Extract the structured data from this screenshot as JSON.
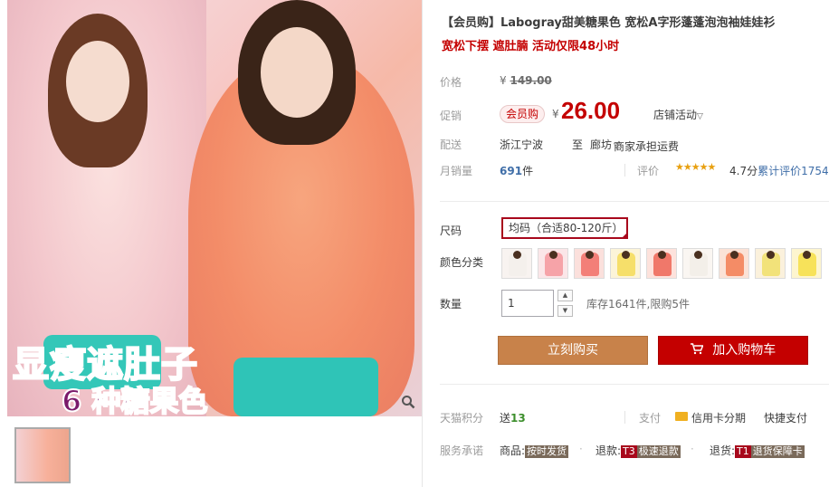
{
  "gallery": {
    "promo_line1": "显瘦遮肚子",
    "promo_line2": "6 种糖果色",
    "zoom_icon": "magnifier-icon"
  },
  "product": {
    "title": "【会员购】Labogray甜美糖果色 宽松A字形蓬蓬泡泡袖娃娃衫",
    "subtitle": "宽松下摆 遮肚腩 活动仅限48小时"
  },
  "price": {
    "label": "价格",
    "currency": "¥",
    "original": "149.00"
  },
  "promo": {
    "label": "促销",
    "badge": "会员购",
    "currency": "¥",
    "price": "26.00",
    "store_activity": "店铺活动",
    "store_activity_icon": "chevron-down-icon"
  },
  "delivery": {
    "label": "配送",
    "from": "浙江宁波",
    "to_word": "至",
    "destination": "廊坊",
    "destination_icon": "chevron-down-icon",
    "fee": "商家承担运费"
  },
  "sales": {
    "label": "月销量",
    "count": "691",
    "unit": "件",
    "eval_label": "评价",
    "stars": "★★★★★",
    "rating": 4.7,
    "score_text": "4.7分",
    "cumulative_label": "累计评价",
    "cumulative_count": "1754"
  },
  "options": {
    "size_label": "尺码",
    "size_value": "均码（合适80-120斤）",
    "color_label": "颜色分类",
    "colors": [
      {
        "name": "swatch-1",
        "shirt": "#f4f0ec",
        "bg": "#f8f3f0"
      },
      {
        "name": "swatch-2",
        "shirt": "#f6a3a8",
        "bg": "#fbe6e8"
      },
      {
        "name": "swatch-3",
        "shirt": "#f37f78",
        "bg": "#fbe0dc"
      },
      {
        "name": "swatch-4",
        "shirt": "#f6df6a",
        "bg": "#fcf4d8"
      },
      {
        "name": "swatch-5",
        "shirt": "#f0786a",
        "bg": "#fde2dc"
      },
      {
        "name": "swatch-6",
        "shirt": "#f3efe9",
        "bg": "#faf6f2"
      },
      {
        "name": "swatch-7",
        "shirt": "#f48c66",
        "bg": "#fbe2d6"
      },
      {
        "name": "swatch-8",
        "shirt": "#f2e27a",
        "bg": "#fbf1dc"
      },
      {
        "name": "swatch-9",
        "shirt": "#f7e25a",
        "bg": "#fdf5cf"
      }
    ],
    "qty_label": "数量",
    "qty_value": "1",
    "stock_text": "库存1641件,限购5件"
  },
  "actions": {
    "buy_now": "立刻购买",
    "add_to_cart": "加入购物车"
  },
  "service": {
    "points_label": "天猫积分",
    "points_prefix": "送",
    "points_value": "13",
    "pay_label": "支付",
    "pay_cc": "信用卡分期",
    "pay_quick": "快捷支付",
    "promise_label": "服务承诺",
    "goods_label": "商品:",
    "goods_tag": "按时发货",
    "refund_label": "退款:",
    "refund_tag_code": "T3",
    "refund_tag": "极速退款",
    "return_label": "退货:",
    "return_tag_code": "T1",
    "return_tag": "退货保障卡"
  },
  "colors": {
    "accent_red": "#c40000",
    "buy_orange": "#c8824a",
    "link_blue": "#3f6ea8",
    "points_green": "#3d8f2d"
  }
}
